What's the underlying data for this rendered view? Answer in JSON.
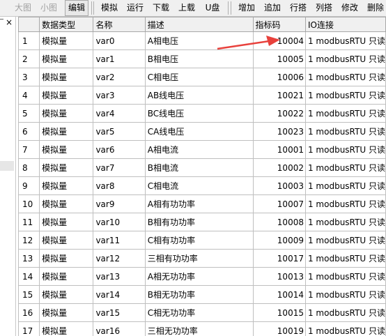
{
  "toolbar": {
    "buttons": [
      "大图",
      "小图",
      "编辑",
      "模拟",
      "运行",
      "下载",
      "上载",
      "U盘",
      "增加",
      "追加",
      "行搭",
      "列搭",
      "修改",
      "删除"
    ]
  },
  "left_panel": {
    "close_glyph": "×"
  },
  "grid": {
    "columns": [
      "数据类型",
      "名称",
      "描述",
      "指标码",
      "IO连接"
    ],
    "rows": [
      {
        "idx": "1",
        "type": "模拟量",
        "name": "var0",
        "desc": "A相电压",
        "code": "10004",
        "io": "1 modbusRTU 只读"
      },
      {
        "idx": "2",
        "type": "模拟量",
        "name": "var1",
        "desc": "B相电压",
        "code": "10005",
        "io": "1 modbusRTU 只读"
      },
      {
        "idx": "3",
        "type": "模拟量",
        "name": "var2",
        "desc": "C相电压",
        "code": "10006",
        "io": "1 modbusRTU 只读"
      },
      {
        "idx": "4",
        "type": "模拟量",
        "name": "var3",
        "desc": "AB线电压",
        "code": "10021",
        "io": "1 modbusRTU 只读"
      },
      {
        "idx": "5",
        "type": "模拟量",
        "name": "var4",
        "desc": "BC线电压",
        "code": "10022",
        "io": "1 modbusRTU 只读"
      },
      {
        "idx": "6",
        "type": "模拟量",
        "name": "var5",
        "desc": "CA线电压",
        "code": "10023",
        "io": "1 modbusRTU 只读"
      },
      {
        "idx": "7",
        "type": "模拟量",
        "name": "var6",
        "desc": "A相电流",
        "code": "10001",
        "io": "1 modbusRTU 只读"
      },
      {
        "idx": "8",
        "type": "模拟量",
        "name": "var7",
        "desc": "B相电流",
        "code": "10002",
        "io": "1 modbusRTU 只读"
      },
      {
        "idx": "9",
        "type": "模拟量",
        "name": "var8",
        "desc": "C相电流",
        "code": "10003",
        "io": "1 modbusRTU 只读"
      },
      {
        "idx": "10",
        "type": "模拟量",
        "name": "var9",
        "desc": "A相有功功率",
        "code": "10007",
        "io": "1 modbusRTU 只读"
      },
      {
        "idx": "11",
        "type": "模拟量",
        "name": "var10",
        "desc": "B相有功功率",
        "code": "10008",
        "io": "1 modbusRTU 只读"
      },
      {
        "idx": "12",
        "type": "模拟量",
        "name": "var11",
        "desc": "C相有功功率",
        "code": "10009",
        "io": "1 modbusRTU 只读"
      },
      {
        "idx": "13",
        "type": "模拟量",
        "name": "var12",
        "desc": "三相有功功率",
        "code": "10017",
        "io": "1 modbusRTU 只读"
      },
      {
        "idx": "14",
        "type": "模拟量",
        "name": "var13",
        "desc": "A相无功功率",
        "code": "10013",
        "io": "1 modbusRTU 只读"
      },
      {
        "idx": "15",
        "type": "模拟量",
        "name": "var14",
        "desc": "B相无功功率",
        "code": "10014",
        "io": "1 modbusRTU 只读"
      },
      {
        "idx": "16",
        "type": "模拟量",
        "name": "var15",
        "desc": "C相无功功率",
        "code": "10015",
        "io": "1 modbusRTU 只读"
      },
      {
        "idx": "17",
        "type": "模拟量",
        "name": "var16",
        "desc": "三相无功功率",
        "code": "10019",
        "io": "1 modbusRTU 只读"
      }
    ]
  },
  "annotation": {
    "arrow_color": "#e8413c"
  }
}
